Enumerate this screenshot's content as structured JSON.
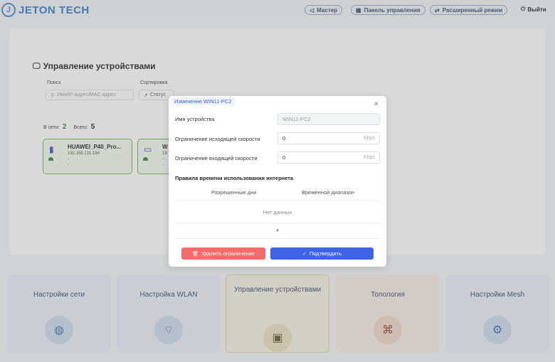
{
  "header": {
    "logo_text": "JETON TECH",
    "buttons": [
      {
        "label": "Мастер",
        "icon": "send-icon"
      },
      {
        "label": "Панель управления",
        "icon": "grid-icon"
      },
      {
        "label": "Расширенный режим",
        "icon": "swap-icon"
      }
    ],
    "logout_label": "Выйти"
  },
  "device_management": {
    "title": "Управление устройствами",
    "search_label": "Поиск",
    "search_placeholder": "Имя/IP-адрес/MAC-адрес",
    "sort_label": "Сортировка",
    "sort_value": "Статус",
    "online_label": "В сети:",
    "online_count": "2",
    "total_label": "Всего:",
    "total_count": "5",
    "devices": [
      {
        "name": "HUAWEI_P40_Pro...",
        "ip": "192.168.131.184",
        "line1": "-",
        "line2": "-",
        "icon": "phone-icon"
      },
      {
        "name": "W",
        "ip": "19",
        "line1": "-",
        "line2": "-",
        "icon": "monitor-icon"
      }
    ]
  },
  "tiles": [
    {
      "label": "Настройки сети",
      "icon": "globe-icon"
    },
    {
      "label": "Настройка WLAN",
      "icon": "wifi-icon"
    },
    {
      "label": "Управление устройствами",
      "icon": "devices-icon",
      "active": true
    },
    {
      "label": "Топология",
      "icon": "topology-icon"
    },
    {
      "label": "Настройки Mesh",
      "icon": "gear-icon"
    }
  ],
  "modal": {
    "title": "Изменение WIN11-PC2",
    "device_name_label": "Имя устройства",
    "device_name_value": "WIN11-PC2",
    "upload_label": "Ограничение исходящей скорости",
    "upload_value": "0",
    "upload_unit": "Kbps",
    "download_label": "Ограничение входящей скорости",
    "download_value": "0",
    "download_unit": "Kbps",
    "rules_title": "Правила времени использования интернета",
    "col_days": "Разрешенные дни",
    "col_range": "Временной диапазон",
    "no_data": "Нет данных",
    "add_symbol": "+",
    "delete_button": "Удалить ограничение",
    "confirm_button": "Подтвердить"
  },
  "colors": {
    "accent": "#3f63e6",
    "danger": "#f56c6c",
    "online_green": "#67c23a",
    "brand": "#2f7fc9"
  }
}
